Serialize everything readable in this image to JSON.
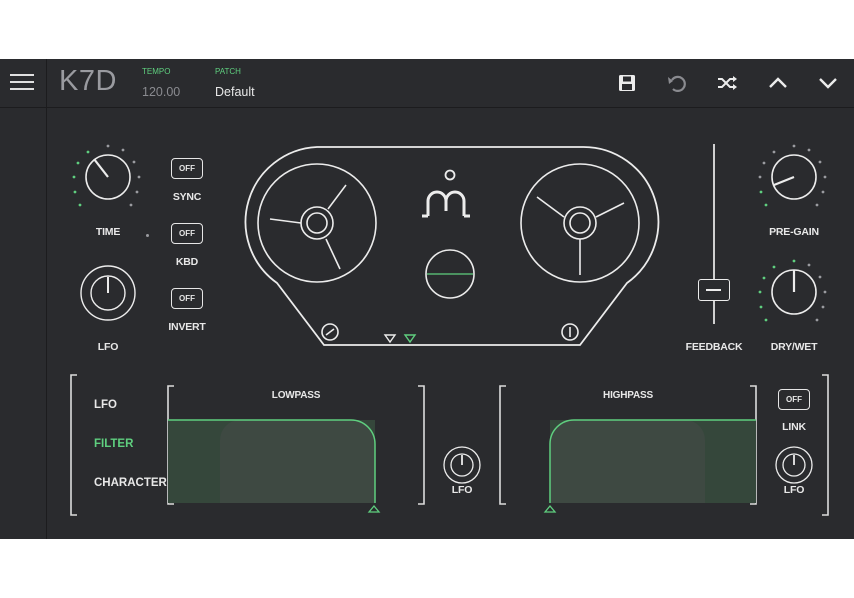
{
  "header": {
    "brand": "K7D",
    "tempo_label": "TEMPO",
    "tempo_value": "120.00",
    "patch_label": "PATCH",
    "patch_value": "Default",
    "icons": [
      "save-icon",
      "undo-icon",
      "shuffle-icon",
      "chevron-up-icon",
      "chevron-down-icon"
    ]
  },
  "controls": {
    "time_label": "TIME",
    "sync_button": "OFF",
    "sync_label": "SYNC",
    "kbd_button": "OFF",
    "kbd_label": "KBD",
    "invert_button": "OFF",
    "invert_label": "INVERT",
    "lfo_label": "LFO",
    "feedback_label": "FEEDBACK",
    "pregain_label": "PRE-GAIN",
    "drywet_label": "DRY/WET"
  },
  "bottom": {
    "menu": [
      "LFO",
      "FILTER",
      "CHARACTER"
    ],
    "active_menu": "FILTER",
    "lowpass_title": "LOWPASS",
    "highpass_title": "HIGHPASS",
    "mid_lfo_label": "LFO",
    "link_button": "OFF",
    "link_label": "LINK",
    "right_lfo_label": "LFO"
  },
  "colors": {
    "background": "#2a2b2e",
    "accent": "#5fcf7f",
    "text": "#e8e8e8"
  }
}
